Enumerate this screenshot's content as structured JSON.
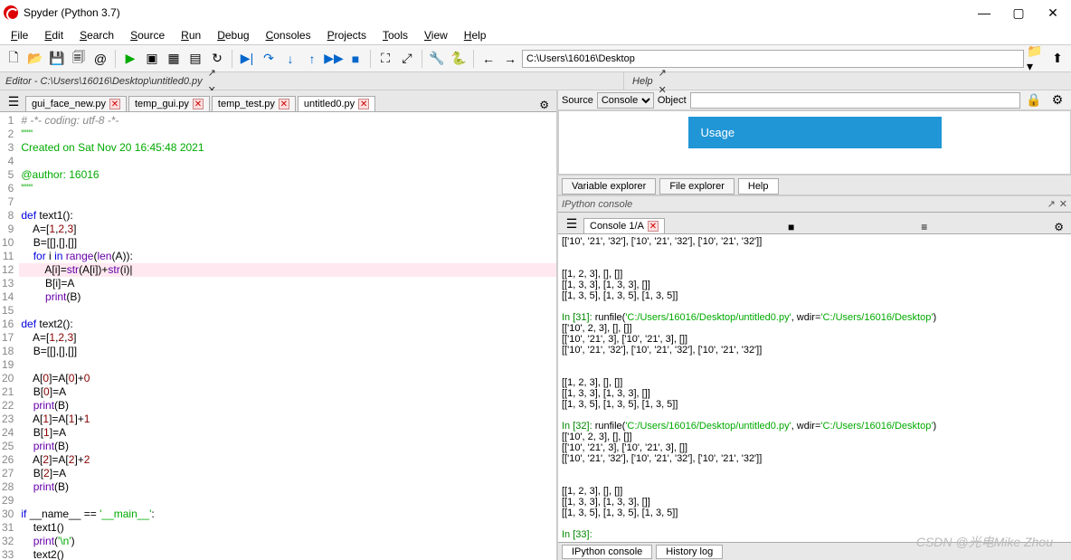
{
  "window": {
    "title": "Spyder (Python 3.7)",
    "min": "—",
    "max": "▢",
    "close": "✕"
  },
  "menu": [
    "File",
    "Edit",
    "Search",
    "Source",
    "Run",
    "Debug",
    "Consoles",
    "Projects",
    "Tools",
    "View",
    "Help"
  ],
  "path": "C:\\Users\\16016\\Desktop",
  "crumb_left": "Editor - C:\\Users\\16016\\Desktop\\untitled0.py",
  "crumb_right": "Help",
  "editor_tabs": [
    {
      "name": "gui_face_new.py",
      "active": false
    },
    {
      "name": "temp_gui.py",
      "active": false
    },
    {
      "name": "temp_test.py",
      "active": false
    },
    {
      "name": "untitled0.py",
      "active": true
    }
  ],
  "code_lines": [
    {
      "n": 1,
      "html": "<span class='c-com'># -*- coding: utf-8 -*-</span>"
    },
    {
      "n": 2,
      "html": "<span class='c-str'>\"\"\"</span>"
    },
    {
      "n": 3,
      "html": "<span class='c-str'>Created on Sat Nov 20 16:45:48 2021</span>"
    },
    {
      "n": 4,
      "html": ""
    },
    {
      "n": 5,
      "html": "<span class='c-str'>@author: 16016</span>"
    },
    {
      "n": 6,
      "html": "<span class='c-str'>\"\"\"</span>"
    },
    {
      "n": 7,
      "html": ""
    },
    {
      "n": 8,
      "html": "<span class='c-kw'>def</span> <span class='c-name'>text1</span>():"
    },
    {
      "n": 9,
      "html": "    A=[<span class='c-num'>1</span>,<span class='c-num'>2</span>,<span class='c-num'>3</span>]"
    },
    {
      "n": 10,
      "html": "    B=[[],[],[]]"
    },
    {
      "n": 11,
      "html": "    <span class='c-kw'>for</span> i <span class='c-kw'>in</span> <span class='c-fn'>range</span>(<span class='c-fn'>len</span>(A)):"
    },
    {
      "n": 12,
      "hl": true,
      "html": "        A[i]=<span class='c-fn'>str</span>(A[i])+<span class='c-fn'>str</span>(i)|"
    },
    {
      "n": 13,
      "html": "        B[i]=A"
    },
    {
      "n": 14,
      "html": "        <span class='c-fn'>print</span>(B)"
    },
    {
      "n": 15,
      "html": ""
    },
    {
      "n": 16,
      "html": "<span class='c-kw'>def</span> <span class='c-name'>text2</span>():"
    },
    {
      "n": 17,
      "html": "    A=[<span class='c-num'>1</span>,<span class='c-num'>2</span>,<span class='c-num'>3</span>]"
    },
    {
      "n": 18,
      "html": "    B=[[],[],[]]"
    },
    {
      "n": 19,
      "html": ""
    },
    {
      "n": 20,
      "html": "    A[<span class='c-num'>0</span>]=A[<span class='c-num'>0</span>]+<span class='c-num'>0</span>"
    },
    {
      "n": 21,
      "html": "    B[<span class='c-num'>0</span>]=A"
    },
    {
      "n": 22,
      "html": "    <span class='c-fn'>print</span>(B)"
    },
    {
      "n": 23,
      "html": "    A[<span class='c-num'>1</span>]=A[<span class='c-num'>1</span>]+<span class='c-num'>1</span>"
    },
    {
      "n": 24,
      "html": "    B[<span class='c-num'>1</span>]=A"
    },
    {
      "n": 25,
      "html": "    <span class='c-fn'>print</span>(B)"
    },
    {
      "n": 26,
      "html": "    A[<span class='c-num'>2</span>]=A[<span class='c-num'>2</span>]+<span class='c-num'>2</span>"
    },
    {
      "n": 27,
      "html": "    B[<span class='c-num'>2</span>]=A"
    },
    {
      "n": 28,
      "html": "    <span class='c-fn'>print</span>(B)"
    },
    {
      "n": 29,
      "html": ""
    },
    {
      "n": 30,
      "html": "<span class='c-kw'>if</span> __name__ == <span class='c-str'>'__main__'</span>:"
    },
    {
      "n": 31,
      "html": "    text1()"
    },
    {
      "n": 32,
      "html": "    <span class='c-fn'>print</span>(<span class='c-str'>'\\n'</span>)"
    },
    {
      "n": 33,
      "html": "    text2()"
    }
  ],
  "help": {
    "source_label": "Source",
    "source_value": "Console",
    "object_label": "Object",
    "usage": "Usage",
    "tabs": [
      "Variable explorer",
      "File explorer",
      "Help"
    ]
  },
  "ipython": {
    "title": "IPython console",
    "tab": "Console 1/A",
    "lines": [
      "[['10', '21', '32'], ['10', '21', '32'], ['10', '21', '32']]",
      "",
      "",
      "[[1, 2, 3], [], []]",
      "[[1, 3, 3], [1, 3, 3], []]",
      "[[1, 3, 5], [1, 3, 5], [1, 3, 5]]",
      "",
      "<span class='in'>In [31]:</span> runfile(<span class='path'>'C:/Users/16016/Desktop/untitled0.py'</span>, wdir=<span class='path'>'C:/Users/16016/Desktop'</span>)",
      "[['10', 2, 3], [], []]",
      "[['10', '21', 3], ['10', '21', 3], []]",
      "[['10', '21', '32'], ['10', '21', '32'], ['10', '21', '32']]",
      "",
      "",
      "[[1, 2, 3], [], []]",
      "[[1, 3, 3], [1, 3, 3], []]",
      "[[1, 3, 5], [1, 3, 5], [1, 3, 5]]",
      "",
      "<span class='in'>In [32]:</span> runfile(<span class='path'>'C:/Users/16016/Desktop/untitled0.py'</span>, wdir=<span class='path'>'C:/Users/16016/Desktop'</span>)",
      "[['10', 2, 3], [], []]",
      "[['10', '21', 3], ['10', '21', 3], []]",
      "[['10', '21', '32'], ['10', '21', '32'], ['10', '21', '32']]",
      "",
      "",
      "[[1, 2, 3], [], []]",
      "[[1, 3, 3], [1, 3, 3], []]",
      "[[1, 3, 5], [1, 3, 5], [1, 3, 5]]",
      "",
      "<span class='in'>In [33]:</span>"
    ],
    "bottom_tabs": [
      "IPython console",
      "History log"
    ]
  },
  "watermark": "CSDN @光电Mike Zhou"
}
